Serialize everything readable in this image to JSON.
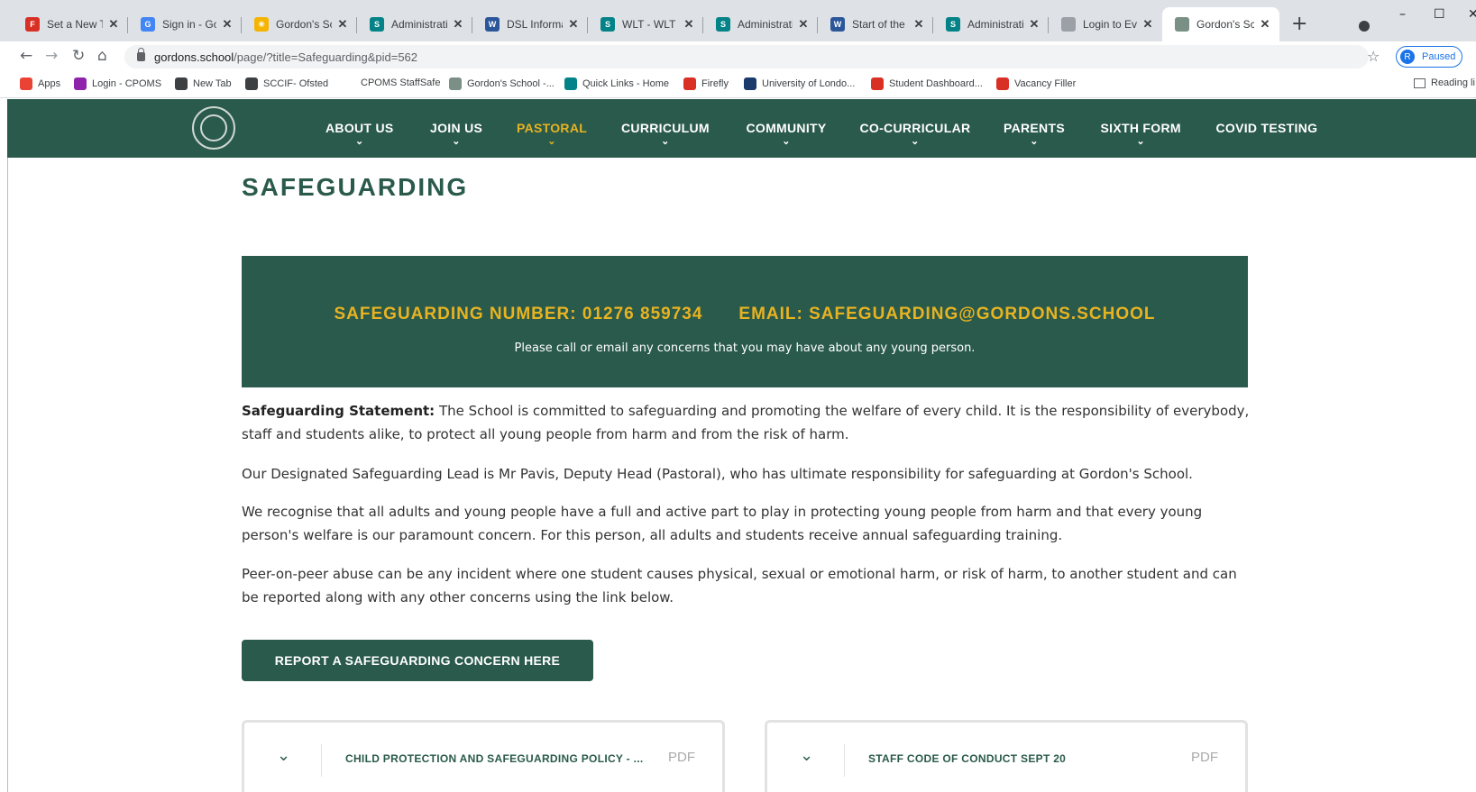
{
  "browser": {
    "tabs": [
      {
        "title": "Set a New Tas",
        "color": "#d93025",
        "glyph": "F"
      },
      {
        "title": "Sign in - Goog",
        "color": "#4285f4",
        "glyph": "G"
      },
      {
        "title": "Gordon's Scho",
        "color": "#f4b400",
        "glyph": "✳"
      },
      {
        "title": "Administration",
        "color": "#038387",
        "glyph": "S"
      },
      {
        "title": "DSL Informati",
        "color": "#2b579a",
        "glyph": "W"
      },
      {
        "title": "WLT - WLT - A",
        "color": "#038387",
        "glyph": "S"
      },
      {
        "title": "Administration",
        "color": "#038387",
        "glyph": "S"
      },
      {
        "title": "Start of the Ye",
        "color": "#2b579a",
        "glyph": "W"
      },
      {
        "title": "Administration",
        "color": "#038387",
        "glyph": "S"
      },
      {
        "title": "Login to Every",
        "color": "#9aa0a6",
        "glyph": ""
      },
      {
        "title": "Gordon's Scho",
        "color": "#7a8f85",
        "glyph": "",
        "active": true
      }
    ],
    "url_host": "gordons.school",
    "url_path": "/page/?title=Safeguarding&pid=562",
    "profile_initial": "R",
    "profile_status": "Paused",
    "bookmarks": [
      {
        "label": "Apps",
        "color": "#ea4335"
      },
      {
        "label": "Login - CPOMS",
        "color": "#8e24aa"
      },
      {
        "label": "New Tab",
        "color": "#3c4043"
      },
      {
        "label": "SCCIF- Ofsted",
        "color": "#3c4043"
      },
      {
        "label": "CPOMS StaffSafe",
        "color": ""
      },
      {
        "label": "Gordon's School -...",
        "color": "#7a8f85"
      },
      {
        "label": "Quick Links - Home",
        "color": "#038387"
      },
      {
        "label": "Firefly",
        "color": "#d93025"
      },
      {
        "label": "University of Londo...",
        "color": "#1a3a6b"
      },
      {
        "label": "Student Dashboard...",
        "color": "#d93025"
      },
      {
        "label": "Vacancy Filler",
        "color": "#d93025"
      }
    ],
    "reading_list": "Reading li"
  },
  "site": {
    "nav": [
      {
        "label": "ABOUT US",
        "has_chevron": true
      },
      {
        "label": "JOIN US",
        "has_chevron": true
      },
      {
        "label": "PASTORAL",
        "has_chevron": true,
        "active": true
      },
      {
        "label": "CURRICULUM",
        "has_chevron": true
      },
      {
        "label": "COMMUNITY",
        "has_chevron": true
      },
      {
        "label": "CO-CURRICULAR",
        "has_chevron": true
      },
      {
        "label": "PARENTS",
        "has_chevron": true
      },
      {
        "label": "SIXTH FORM",
        "has_chevron": true
      },
      {
        "label": "COVID TESTING",
        "has_chevron": false
      }
    ],
    "accent_color": "#2a5a4b",
    "highlight_color": "#e8b321"
  },
  "page": {
    "title": "SAFEGUARDING",
    "banner": {
      "number": "SAFEGUARDING NUMBER: 01276 859734",
      "email": "EMAIL: SAFEGUARDING@GORDONS.SCHOOL",
      "subtext": "Please call or email any concerns that you may have about any young person."
    },
    "statement_label": "Safeguarding Statement:",
    "statement_text": " The School is committed to safeguarding and promoting the welfare of every child. It is the responsibility of everybody, staff and students alike, to protect all young people from harm and from the risk of harm.",
    "para2": "Our Designated Safeguarding Lead is Mr Pavis, Deputy Head (Pastoral), who has ultimate responsibility for safeguarding at Gordon's School.",
    "para3": "We recognise that all adults and young people have a full and active part to play in protecting young people from harm and that every young person's welfare is our paramount concern. For this person, all adults and students receive annual safeguarding training.",
    "para4": "Peer-on-peer abuse can be any incident where one student causes physical, sexual or emotional harm, or risk of harm, to another student and can be reported along with any other concerns using the link below.",
    "report_button": "REPORT A SAFEGUARDING CONCERN HERE",
    "documents": [
      {
        "title": "CHILD PROTECTION AND SAFEGUARDING POLICY - ...",
        "type": "PDF"
      },
      {
        "title": "STAFF CODE OF CONDUCT SEPT 20",
        "type": "PDF"
      }
    ]
  }
}
